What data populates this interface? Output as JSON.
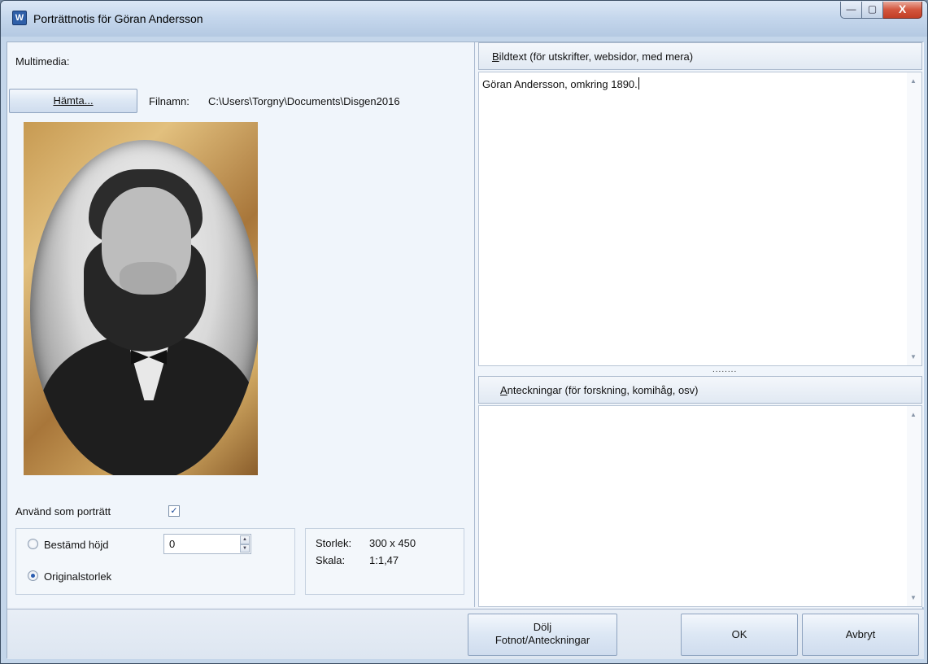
{
  "window": {
    "title": "Porträttnotis för Göran Andersson",
    "app_icon_glyph": "W",
    "controls": {
      "minimize": "—",
      "maximize": "▢",
      "close": "X"
    }
  },
  "left": {
    "multimedia_label": "Multimedia:",
    "fetch_button": "Hämta...",
    "filename_label": "Filnamn:",
    "filename_value": "C:\\Users\\Torgny\\Documents\\Disgen2016",
    "use_as_portrait_label": "Använd som porträtt",
    "use_as_portrait_checked": "✓",
    "size_options": {
      "fixed_height_label": "Bestämd höjd",
      "fixed_height_value": "0",
      "original_size_label": "Originalstorlek",
      "selected": "original"
    },
    "info": {
      "size_label": "Storlek:",
      "size_value": "300 x 450",
      "scale_label": "Skala:",
      "scale_value": "1:1,47"
    }
  },
  "right": {
    "caption_header_first": "B",
    "caption_header_rest": "ildtext (för utskrifter, websidor, med mera)",
    "caption_text": "Göran Andersson, omkring 1890.",
    "notes_header_first": "A",
    "notes_header_rest": "nteckningar (för forskning, komihåg, osv)",
    "notes_text": "",
    "splitter_glyph": "........"
  },
  "buttons": {
    "hide_line1": "Dölj",
    "hide_line2": "Fotnot/Anteckningar",
    "ok": "OK",
    "cancel": "Avbryt"
  },
  "icons": {
    "scroll_up": "▲",
    "scroll_down": "▼",
    "spin_up": "▲",
    "spin_down": "▼"
  }
}
